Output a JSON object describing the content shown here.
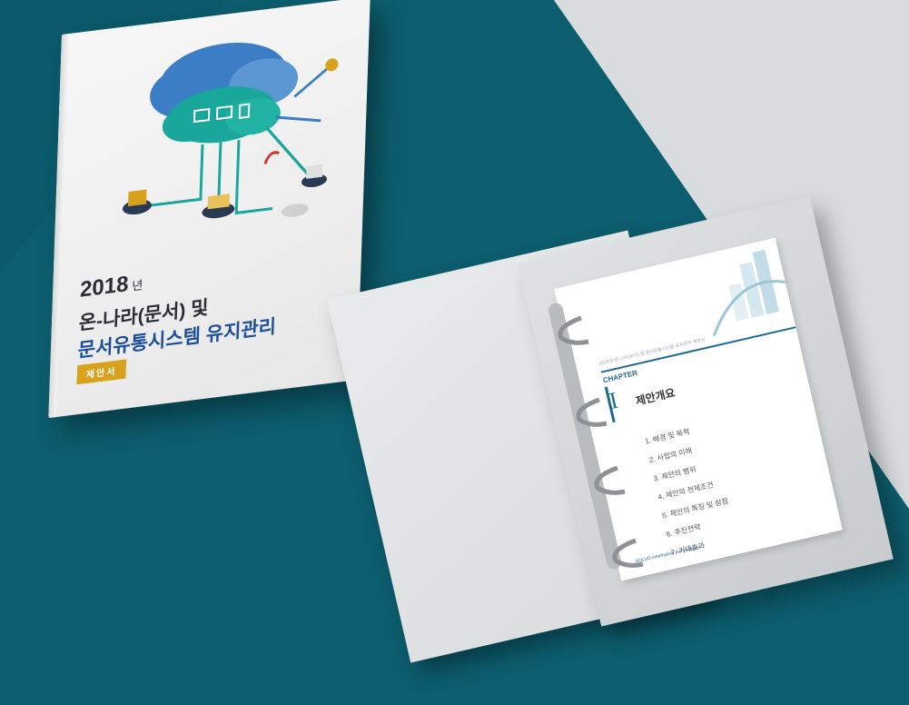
{
  "colors": {
    "teal": "#0c5d6e",
    "grey": "#c9cccf",
    "navy_text": "#1d4f9a",
    "gold": "#d8a21c",
    "cloud_blue": "#3b7ec6",
    "cloud_teal": "#18a79a"
  },
  "cover": {
    "year": "2018",
    "year_suffix": "년",
    "line1": "온-나라(문서) 및",
    "line2": "문서유통시스템 유지관리",
    "badge": "제안서",
    "illustration_icons": [
      "cloud-icon",
      "server-icon",
      "laptop-icon",
      "monitor-icon",
      "database-icon",
      "wifi-icon",
      "gear-icon",
      "truck-icon"
    ]
  },
  "page": {
    "header": "2018년 온-나라(문서) 및 문서유통시스템 유지관리 제안서",
    "chapter_label": "CHAPTER",
    "chapter_number": "I",
    "chapter_title": "제안개요",
    "toc": [
      "1. 배경 및 목적",
      "2. 사업의 이해",
      "3. 제안의 범위",
      "4. 제안의 전제조건",
      "5. 제안의 특징 및 장점",
      "6. 추진전략",
      "7. 기대효과"
    ],
    "footer": "SOLUO information technologies"
  }
}
